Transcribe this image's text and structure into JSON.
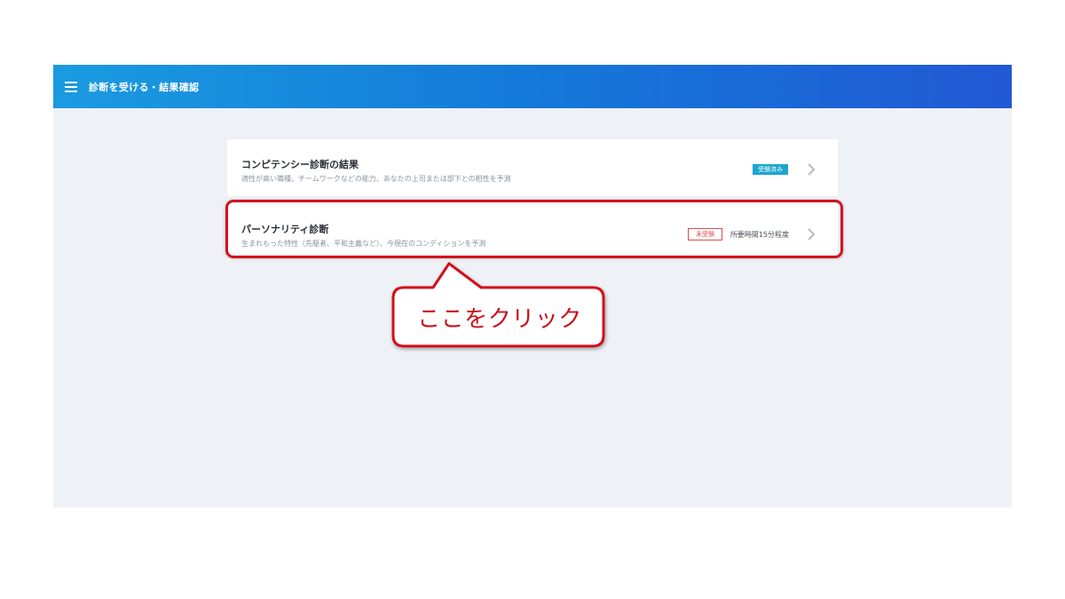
{
  "header": {
    "title": "診断を受ける・結果確認",
    "menu_icon": "hamburger-menu-icon"
  },
  "cards": [
    {
      "title": "コンピテンシー診断の結果",
      "description": "適性が高い職種、チームワークなどの能力、あなたの上司または部下との相性を予測",
      "badge": "受験済み",
      "badge_color": "#1aa6cf",
      "icon": "chevron-right-icon"
    },
    {
      "title": "パーソナリティ診断",
      "description": "生まれもった特性（先駆者、平和主義など）、今現在のコンディションを予測",
      "badge": "未受験",
      "badge_color": "#e04a4a",
      "duration": "所要時間15分程度",
      "icon": "chevron-right-icon"
    }
  ],
  "annotation": {
    "callout_text": "ここをクリック",
    "color": "#d4101e"
  }
}
